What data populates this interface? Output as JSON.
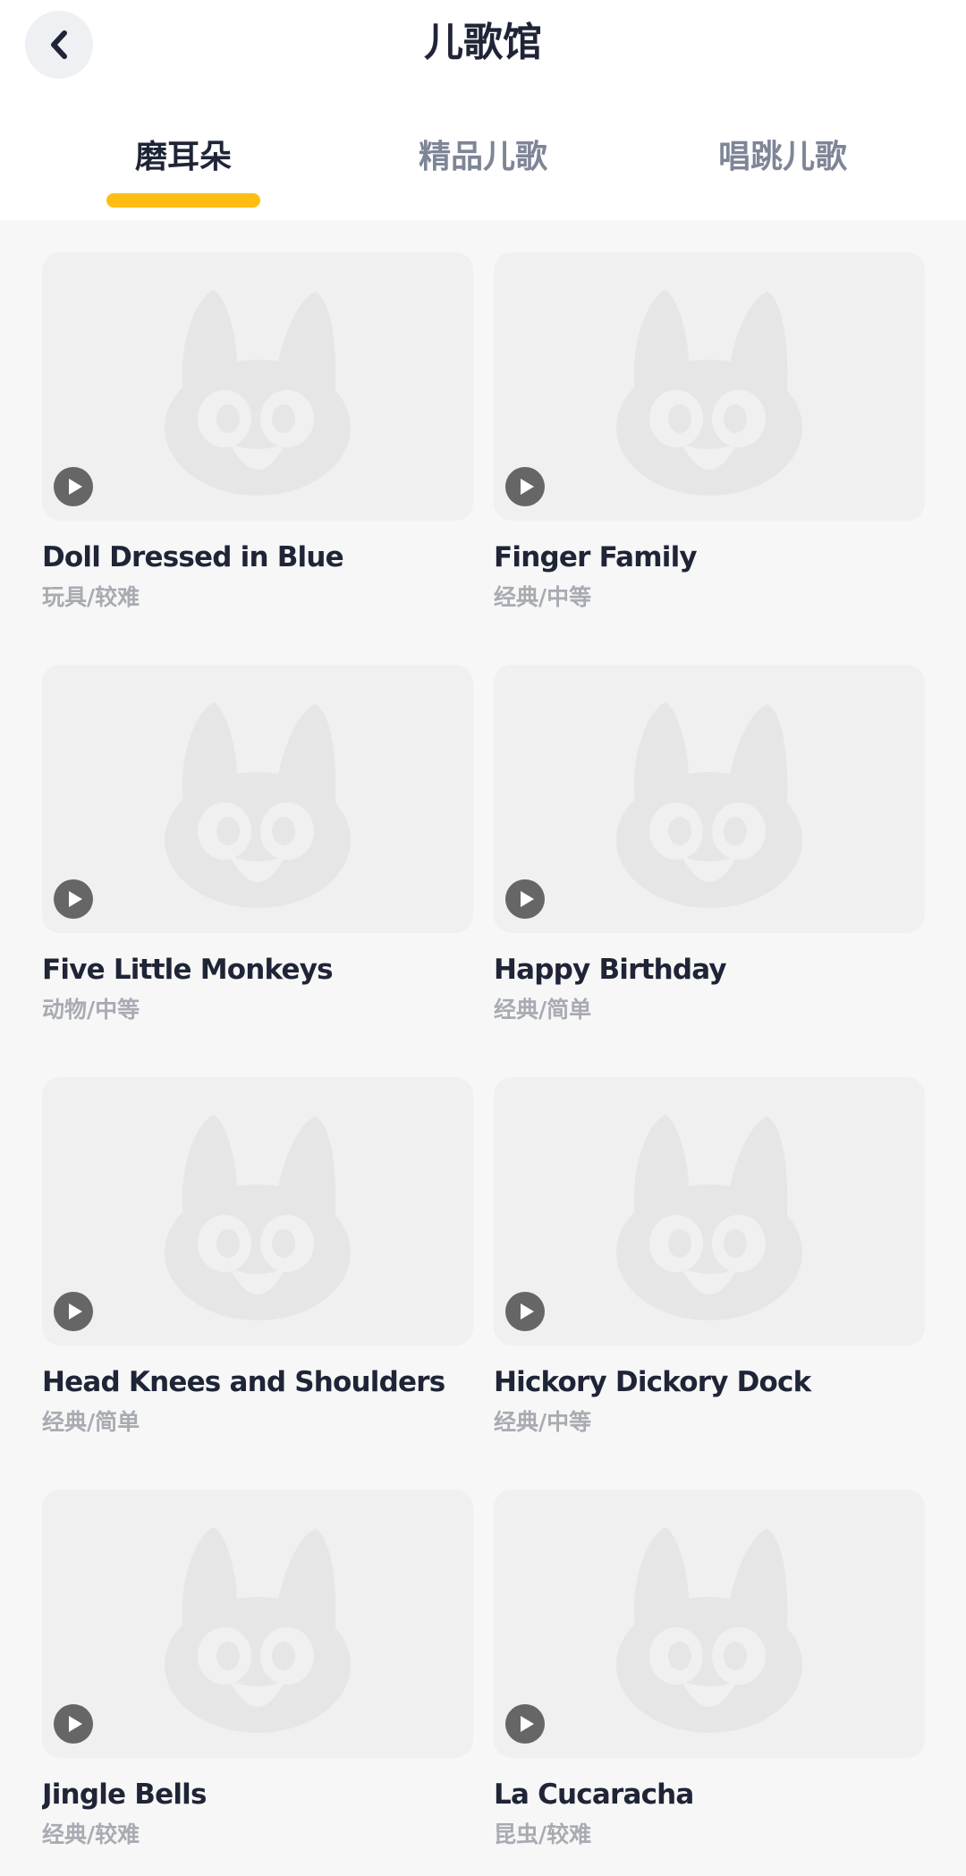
{
  "header": {
    "title": "儿歌馆",
    "back_icon": "chevron-left-icon"
  },
  "tabs": [
    {
      "label": "磨耳朵",
      "active": true
    },
    {
      "label": "精品儿歌",
      "active": false
    },
    {
      "label": "唱跳儿歌",
      "active": false
    }
  ],
  "colors": {
    "accent": "#ffbd14",
    "text_primary": "#1f2537",
    "text_tab_inactive": "#7e8596",
    "text_secondary": "#a8abb2",
    "thumb_bg": "#f0f0f0",
    "play_button": "#666666"
  },
  "songs": [
    {
      "title": "Doll Dressed in Blue",
      "tags": "玩具/较难",
      "icon": "play-icon"
    },
    {
      "title": "Finger Family",
      "tags": "经典/中等",
      "icon": "play-icon"
    },
    {
      "title": "Five Little Monkeys",
      "tags": "动物/中等",
      "icon": "play-icon"
    },
    {
      "title": "Happy Birthday",
      "tags": "经典/简单",
      "icon": "play-icon"
    },
    {
      "title": "Head Knees and Shoulders",
      "tags": "经典/简单",
      "icon": "play-icon"
    },
    {
      "title": "Hickory Dickory Dock",
      "tags": "经典/中等",
      "icon": "play-icon"
    },
    {
      "title": "Jingle Bells",
      "tags": "经典/较难",
      "icon": "play-icon"
    },
    {
      "title": "La Cucaracha",
      "tags": "昆虫/较难",
      "icon": "play-icon"
    }
  ]
}
